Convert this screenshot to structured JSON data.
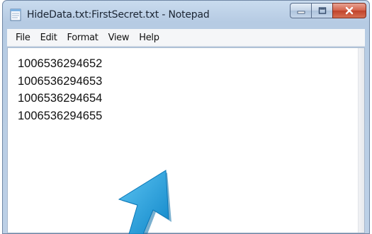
{
  "window": {
    "title": "HideData.txt:FirstSecret.txt - Notepad",
    "app_icon": "notepad-icon"
  },
  "caption_buttons": {
    "minimize_icon": "minimize-icon",
    "maximize_icon": "maximize-icon",
    "close_icon": "close-icon"
  },
  "menu": {
    "items": [
      {
        "label": "File"
      },
      {
        "label": "Edit"
      },
      {
        "label": "Format"
      },
      {
        "label": "View"
      },
      {
        "label": "Help"
      }
    ]
  },
  "editor": {
    "lines": [
      "1006536294652",
      "1006536294653",
      "1006536294654",
      "1006536294655"
    ]
  },
  "overlay": {
    "arrow_icon": "arrow-up-icon",
    "arrow_color": "#1ea6e6"
  }
}
